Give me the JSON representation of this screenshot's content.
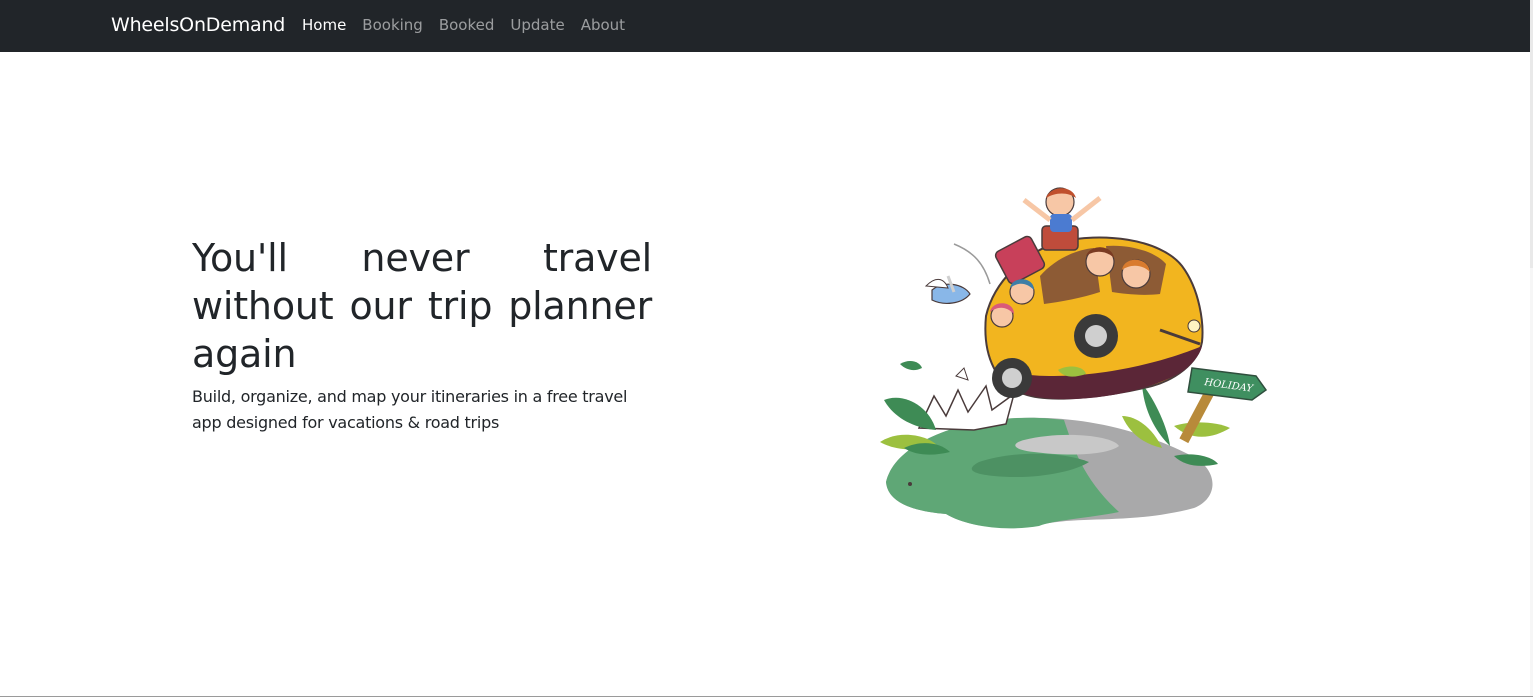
{
  "navbar": {
    "brand": "WheelsOnDemand",
    "links": [
      {
        "label": "Home",
        "active": true
      },
      {
        "label": "Booking",
        "active": false
      },
      {
        "label": "Booked",
        "active": false
      },
      {
        "label": "Update",
        "active": false
      },
      {
        "label": "About",
        "active": false
      }
    ]
  },
  "hero": {
    "title": "You'll never travel without our trip planner again",
    "subtitle": "Build, organize, and map your itineraries in a free travel app designed for vacations & road trips",
    "illustration": {
      "icon": "travel-car-illustration",
      "sign_text": "HOLIDAY"
    }
  },
  "colors": {
    "navbar_bg": "#212529",
    "car_yellow": "#f2b51f",
    "hill_green": "#5fa776",
    "sign_green": "#3f8f60",
    "text_dark": "#212529"
  }
}
